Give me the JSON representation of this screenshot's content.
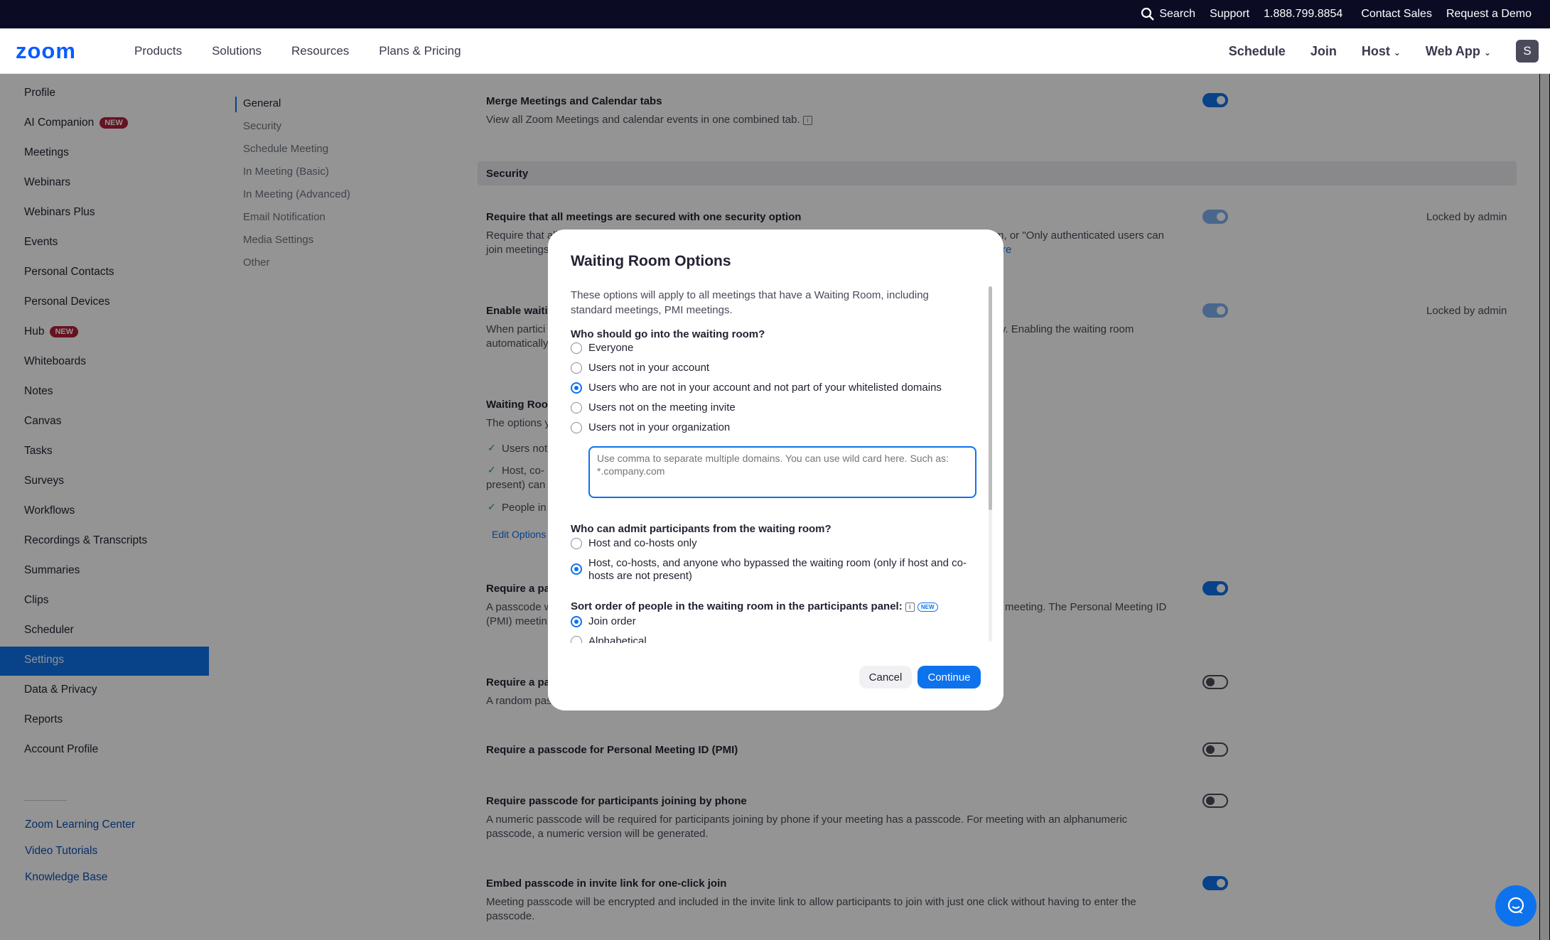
{
  "topbar": {
    "search": "Search",
    "support": "Support",
    "phone": "1.888.799.8854",
    "contact_sales": "Contact Sales",
    "request_demo": "Request a Demo"
  },
  "nav": {
    "logo": "zoom",
    "left": [
      "Products",
      "Solutions",
      "Resources",
      "Plans & Pricing"
    ],
    "schedule": "Schedule",
    "join": "Join",
    "host": "Host",
    "web_app": "Web App",
    "avatar": "S"
  },
  "sidebar": {
    "items": [
      "Profile",
      "AI Companion",
      "Meetings",
      "Webinars",
      "Webinars Plus",
      "Events",
      "Personal Contacts",
      "Personal Devices",
      "Hub",
      "Whiteboards",
      "Notes",
      "Canvas",
      "Tasks",
      "Surveys",
      "Workflows",
      "Recordings & Transcripts",
      "Summaries",
      "Clips",
      "Scheduler",
      "Settings",
      "Data & Privacy",
      "Reports",
      "Account Profile"
    ],
    "new_badge": "NEW",
    "links": [
      "Zoom Learning Center",
      "Video Tutorials",
      "Knowledge Base"
    ]
  },
  "subnav": [
    "General",
    "Security",
    "Schedule Meeting",
    "In Meeting (Basic)",
    "In Meeting (Advanced)",
    "Email Notification",
    "Media Settings",
    "Other"
  ],
  "settings": {
    "merge_title": "Merge Meetings and Calendar tabs",
    "merge_desc": "View all Zoom Meetings and calendar events in one combined tab.",
    "security_header": "Security",
    "secure_title": "Require that all meetings are secured with one security option",
    "secure_desc_a": "Require that all",
    "secure_desc_b": "m, or \"Only authenticated users can",
    "secure_desc_c": "join meetings",
    "secure_desc_more": "re",
    "locked": "Locked by admin",
    "waiting_title_a": "Enable waiti",
    "waiting_desc_a": "When partici",
    "waiting_desc_b": "ally. Enabling the waiting room",
    "waiting_desc_c": "automatically",
    "wr_options_title": "Waiting Room",
    "wr_options_desc": "The options y",
    "wr_check1": "Users not",
    "wr_check2a": "Host, co-",
    "wr_check2b": "present) can",
    "wr_check3": "People in",
    "edit_options": "Edit Options",
    "passcode_title_a": "Require a pa",
    "passcode_desc_a": "A passcode w",
    "passcode_desc_b": "meeting. The Personal Meeting ID",
    "passcode_desc_c": "(PMI) meetin",
    "passcode2_title": "Require a pa",
    "passcode2_desc": "A random pas",
    "pmi_title": "Require a passcode for Personal Meeting ID (PMI)",
    "phone_title": "Require passcode for participants joining by phone",
    "phone_desc": "A numeric passcode will be required for participants joining by phone if your meeting has a passcode. For meeting with an alphanumeric passcode, a numeric version will be generated.",
    "embed_title": "Embed passcode in invite link for one-click join",
    "embed_desc": "Meeting passcode will be encrypted and included in the invite link to allow participants to join with just one click without having to enter the passcode."
  },
  "dialog": {
    "title": "Waiting Room Options",
    "intro": "These options will apply to all meetings that have a Waiting Room, including standard meetings, PMI meetings.",
    "q1": "Who should go into the waiting room?",
    "q1_options": [
      "Everyone",
      "Users not in your account",
      "Users who are not in your account and not part of your whitelisted domains",
      "Users not on the meeting invite",
      "Users not in your organization"
    ],
    "q1_selected": 2,
    "domains_placeholder": "Use comma to separate multiple domains. You can use wild card here. Such as: *.company.com",
    "q2": "Who can admit participants from the waiting room?",
    "q2_options": [
      "Host and co-hosts only",
      "Host, co-hosts, and anyone who bypassed the waiting room (only if host and co-hosts are not present)"
    ],
    "q2_selected": 1,
    "q3": "Sort order of people in the waiting room in the participants panel:",
    "q3_badge": "NEW",
    "q3_options": [
      "Join order",
      "Alphabetical"
    ],
    "q3_selected": 0,
    "cancel": "Cancel",
    "continue": "Continue"
  },
  "colors": {
    "accent": "#0e72ed",
    "topbar": "#0b0c24",
    "new_badge": "#b01f3b"
  }
}
